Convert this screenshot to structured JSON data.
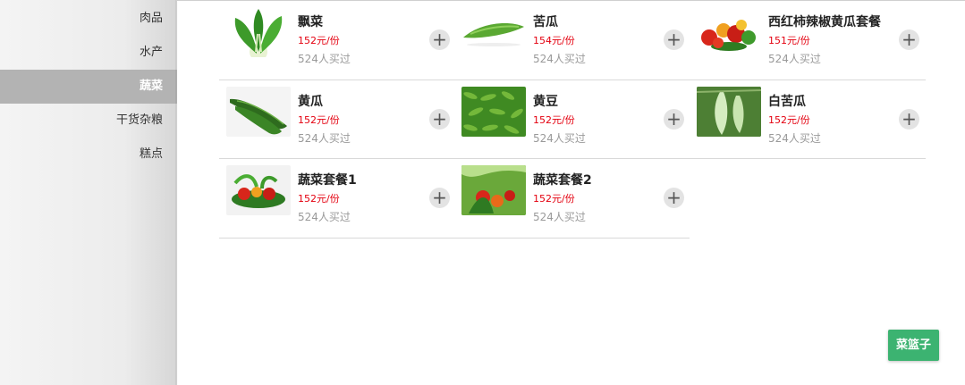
{
  "sidebar": {
    "items": [
      {
        "label": "肉品"
      },
      {
        "label": "水产"
      },
      {
        "label": "蔬菜"
      },
      {
        "label": "干货杂粮"
      },
      {
        "label": "糕点"
      }
    ],
    "active": "蔬菜"
  },
  "products": [
    {
      "name": "飘菜",
      "price": "152元/份",
      "sold": "524人买过",
      "image": "bok-choy"
    },
    {
      "name": "苦瓜",
      "price": "154元/份",
      "sold": "524人买过",
      "image": "bitter-melon"
    },
    {
      "name": "西红柿辣椒黄瓜套餐",
      "price": "151元/份",
      "sold": "524人买过",
      "image": "tomato-pepper-cucumber"
    },
    {
      "name": "黄瓜",
      "price": "152元/份",
      "sold": "524人买过",
      "image": "cucumber"
    },
    {
      "name": "黄豆",
      "price": "152元/份",
      "sold": "524人买过",
      "image": "soybean"
    },
    {
      "name": "白苦瓜",
      "price": "152元/份",
      "sold": "524人买过",
      "image": "white-bitter-melon"
    },
    {
      "name": "蔬菜套餐1",
      "price": "152元/份",
      "sold": "524人买过",
      "image": "vegetable-set-1"
    },
    {
      "name": "蔬菜套餐2",
      "price": "152元/份",
      "sold": "524人买过",
      "image": "vegetable-set-2"
    }
  ],
  "add_button": {
    "symbol": "+"
  },
  "basket_button": {
    "label": "菜篮子"
  },
  "colors": {
    "accent": "#3cb371",
    "price": "#e4000f",
    "active_sidebar": "#b3b3b3"
  }
}
